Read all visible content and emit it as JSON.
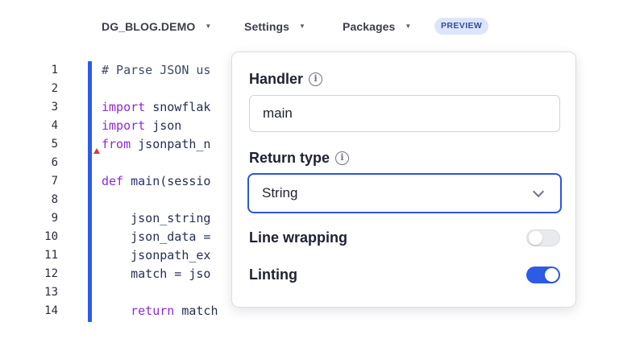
{
  "toolbar": {
    "database": "DG_BLOG.DEMO",
    "settings": "Settings",
    "packages": "Packages",
    "badge": "PREVIEW"
  },
  "editor": {
    "line_numbers": [
      "1",
      "2",
      "3",
      "4",
      "5",
      "6",
      "7",
      "8",
      "9",
      "10",
      "11",
      "12",
      "13",
      "14"
    ],
    "lines": {
      "l1": "# Parse JSON us",
      "l3_kw": "import",
      "l3_rest": " snowflak",
      "l4_kw": "import",
      "l4_rest": " json",
      "l5_kw": "from",
      "l5_rest": " jsonpath_n",
      "l7_kw": "def",
      "l7_fn": " main",
      "l7_rest": "(sessio",
      "l9": "    json_string",
      "l10": "    json_data =",
      "l11": "    jsonpath_ex",
      "l12": "    match = jso",
      "l14_kw": "    return",
      "l14_rest": " match"
    }
  },
  "popover": {
    "handler_label": "Handler",
    "handler_value": "main",
    "return_type_label": "Return type",
    "return_type_value": "String",
    "line_wrapping_label": "Line wrapping",
    "line_wrapping_on": false,
    "linting_label": "Linting",
    "linting_on": true
  },
  "colors": {
    "accent": "#2c5be6",
    "keyword": "#8a2bd6",
    "badge_bg": "#dde5fb"
  }
}
